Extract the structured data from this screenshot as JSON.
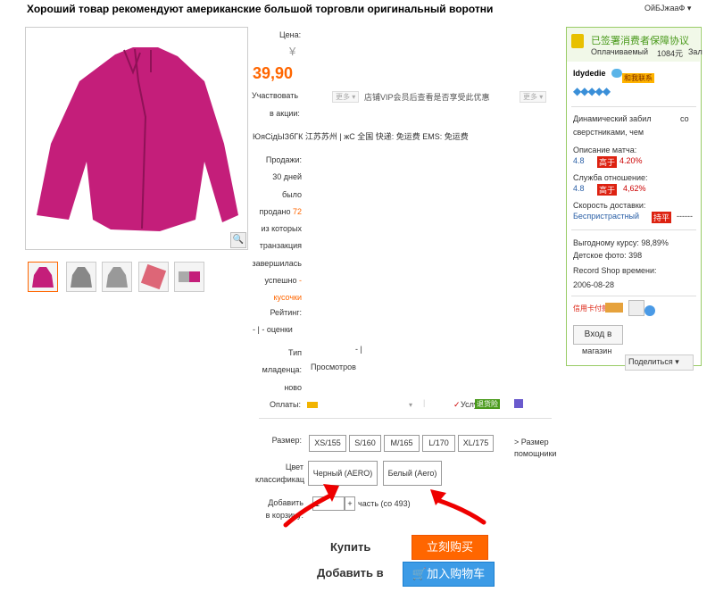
{
  "title": "Хороший товар рекомендуют американские большой торговли оригинальный воротни",
  "top_right": "ОйБЈжааФ",
  "product": {
    "price_label": "Цена:",
    "currency": "¥",
    "price": "39,90",
    "promo_label_1": "Участвовать",
    "promo_label_2": "в акции:",
    "more_1": "更多",
    "promo_text": "店铺VIP会员后查看是否享受此优惠",
    "more_2": "更多",
    "shipping": "ЮяСідЫЗбГК   江苏苏州 | жС 全国   快递: 免运费  EMS: 免运费",
    "sales": [
      "Продажи:",
      "30 дней",
      "было",
      "продано",
      "72",
      "из которых",
      "транзакция",
      "завершилась",
      "успешно",
      "-",
      "кусочки"
    ],
    "rating_label": "Рейтинг:",
    "rating_text": "- | - оценки",
    "type_label": [
      "Тип",
      "младенца:",
      "ново"
    ],
    "type_value": "Просмотров",
    "type_marks": "-   |",
    "payment_label": "Оплаты:",
    "service_label": "Услуг",
    "service_badge": "退货险",
    "size_label": "Размер:",
    "sizes": [
      "XS/155",
      "S/160",
      "M/165",
      "L/170",
      "XL/175"
    ],
    "size_helper": [
      "> Размер",
      "помощники"
    ],
    "color_label": [
      "Цвет",
      "классификац"
    ],
    "colors": [
      "Черный (AERO)",
      "Белый (Aero)"
    ],
    "qty_label": [
      "Добавить",
      "в корзину:"
    ],
    "qty_value": "1",
    "qty_plus": "+",
    "qty_unit": "часть (со 493)",
    "buy_label": "Купить",
    "buy_button": "立刻购买",
    "cart_label": "Добавить в",
    "cart_button": "加入购物车"
  },
  "sidebar": {
    "guarantee_title": "已签署消费者保障协议",
    "paid_label": "Оплачиваемый",
    "paid_value": "1084元",
    "paid_suffix": "Зал",
    "seller": "ldydedie",
    "contact": "和我联系",
    "dynamic_label": "Динамический забил",
    "dynamic_suffix": "со",
    "dynamic_label2": "сверстниками, чем",
    "desc_label": "Описание матча:",
    "desc_value": "4.8",
    "desc_badge": "高于",
    "desc_pct": "4.20%",
    "service_label": "Служба отношение:",
    "service_value": "4.8",
    "service_badge": "高于",
    "service_pct": "4,62%",
    "delivery_label": "Скорость доставки:",
    "delivery_value": "Беспристрастный",
    "delivery_badge": "持平",
    "delivery_pct": "------",
    "course_label": "Выгодному курсу:",
    "course_value": "98,89%",
    "photo_label": "Детское фото:",
    "photo_value": "398",
    "record_label": "Record Shop времени:",
    "record_value": "2006-08-28",
    "credit_label": "信用卡付款",
    "enter_button": "Вход в",
    "enter_button2": "магазин",
    "share": "Поделиться"
  },
  "colors": {
    "accent_orange": "#ff6600",
    "price_orange": "#f60",
    "cart_blue": "#3c9be6",
    "sidebar_green": "#99cc66",
    "jacket_pink": "#c41e7a"
  }
}
